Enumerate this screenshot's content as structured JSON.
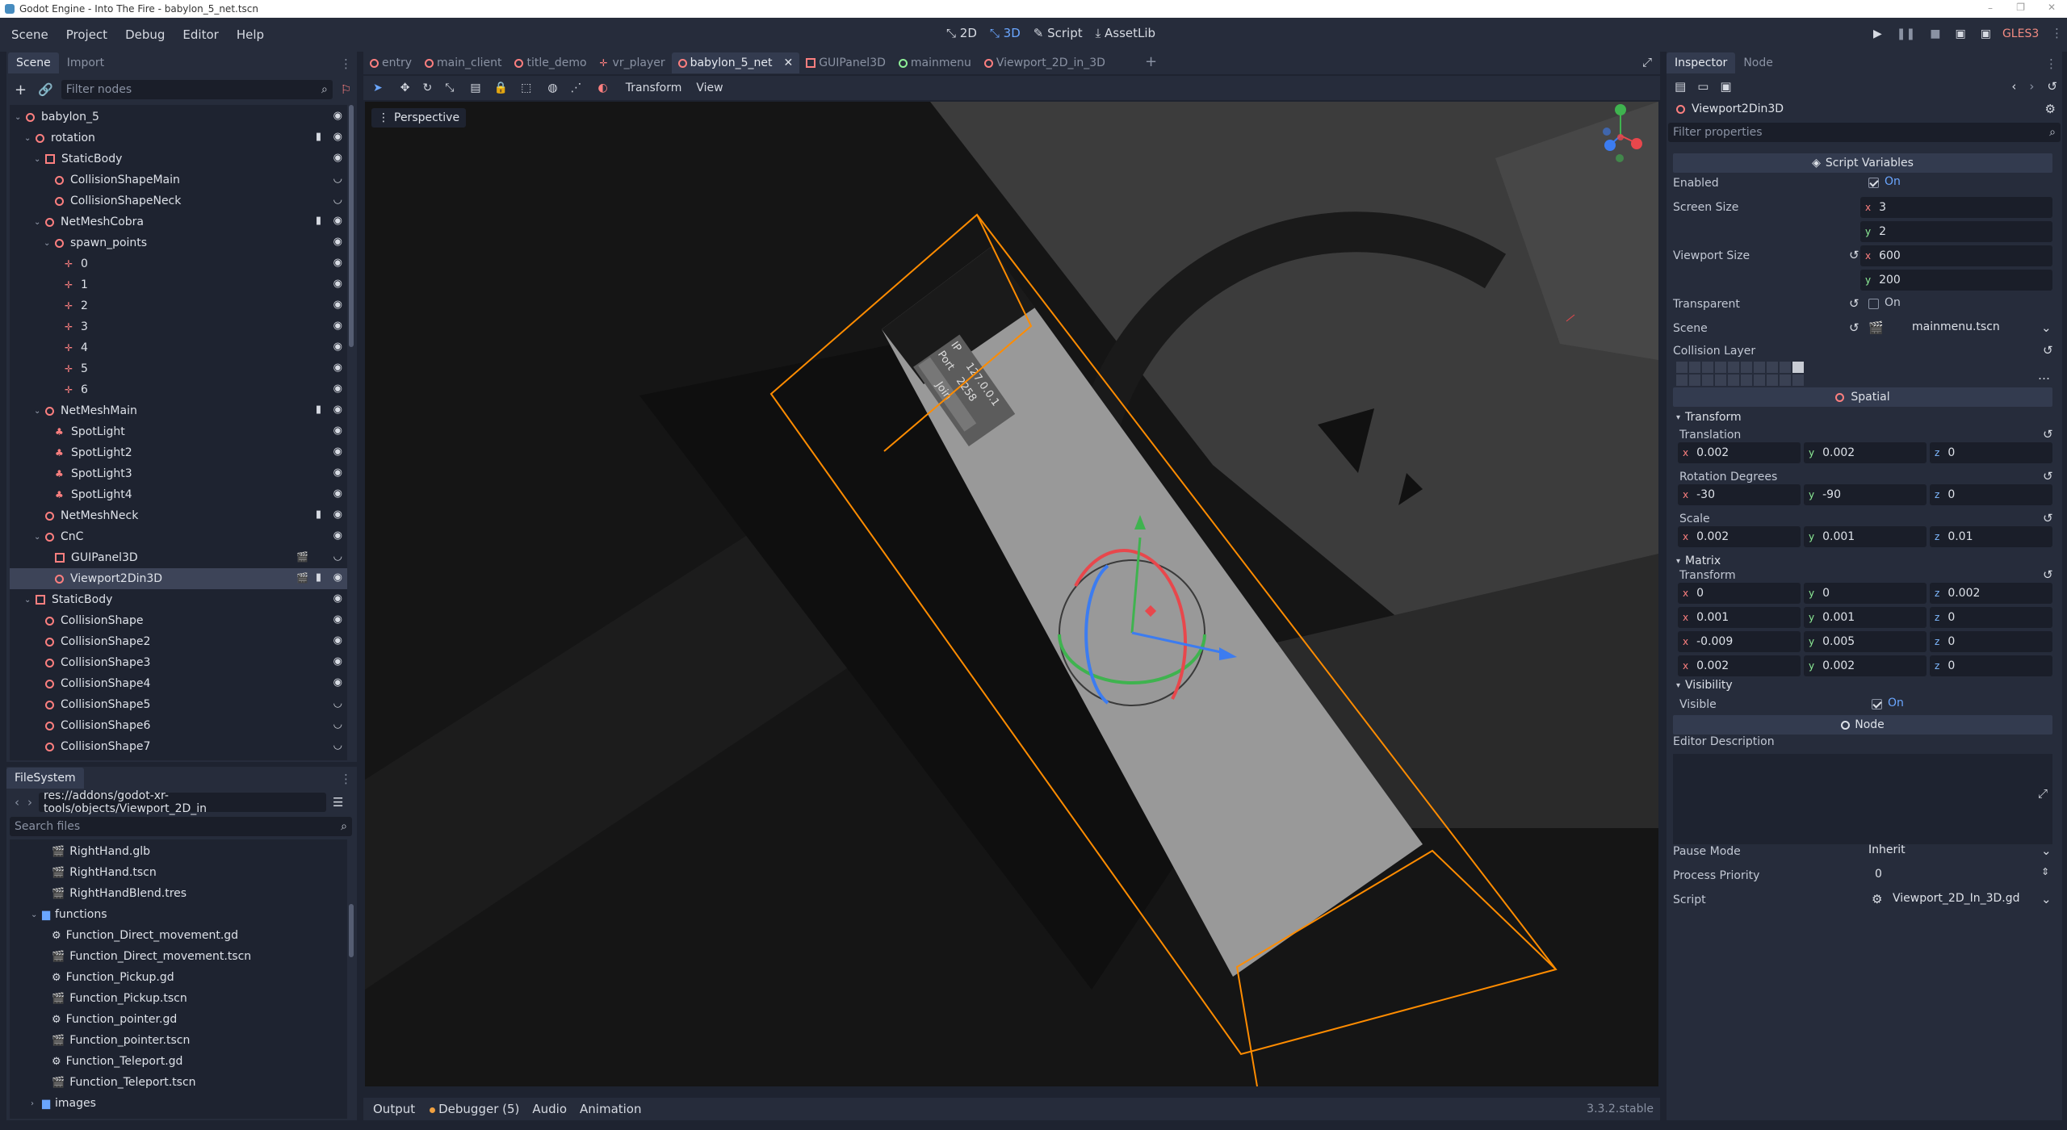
{
  "window": {
    "title": "Godot Engine - Into The Fire - babylon_5_net.tscn"
  },
  "menu": [
    "Scene",
    "Project",
    "Debug",
    "Editor",
    "Help"
  ],
  "workspaces": [
    "2D",
    "3D",
    "Script",
    "AssetLib"
  ],
  "renderer": "GLES3",
  "scene_dock": {
    "tabs": [
      "Scene",
      "Import"
    ],
    "filter_placeholder": "Filter nodes",
    "nodes": [
      {
        "label": "babylon_5"
      },
      {
        "label": "rotation"
      },
      {
        "label": "StaticBody"
      },
      {
        "label": "CollisionShapeMain"
      },
      {
        "label": "CollisionShapeNeck"
      },
      {
        "label": "NetMeshCobra"
      },
      {
        "label": "spawn_points"
      },
      {
        "label": "0"
      },
      {
        "label": "1"
      },
      {
        "label": "2"
      },
      {
        "label": "3"
      },
      {
        "label": "4"
      },
      {
        "label": "5"
      },
      {
        "label": "6"
      },
      {
        "label": "NetMeshMain"
      },
      {
        "label": "SpotLight"
      },
      {
        "label": "SpotLight2"
      },
      {
        "label": "SpotLight3"
      },
      {
        "label": "SpotLight4"
      },
      {
        "label": "NetMeshNeck"
      },
      {
        "label": "CnC"
      },
      {
        "label": "GUIPanel3D"
      },
      {
        "label": "Viewport2Din3D"
      },
      {
        "label": "StaticBody"
      },
      {
        "label": "CollisionShape"
      },
      {
        "label": "CollisionShape2"
      },
      {
        "label": "CollisionShape3"
      },
      {
        "label": "CollisionShape4"
      },
      {
        "label": "CollisionShape5"
      },
      {
        "label": "CollisionShape6"
      },
      {
        "label": "CollisionShape7"
      }
    ]
  },
  "filesystem": {
    "title": "FileSystem",
    "path": "res://addons/godot-xr-tools/objects/Viewport_2D_in",
    "search_placeholder": "Search files",
    "files": [
      {
        "label": "RightHand.glb"
      },
      {
        "label": "RightHand.tscn"
      },
      {
        "label": "RightHandBlend.tres"
      },
      {
        "label": "functions"
      },
      {
        "label": "Function_Direct_movement.gd"
      },
      {
        "label": "Function_Direct_movement.tscn"
      },
      {
        "label": "Function_Pickup.gd"
      },
      {
        "label": "Function_Pickup.tscn"
      },
      {
        "label": "Function_pointer.gd"
      },
      {
        "label": "Function_pointer.tscn"
      },
      {
        "label": "Function_Teleport.gd"
      },
      {
        "label": "Function_Teleport.tscn"
      },
      {
        "label": "images"
      }
    ]
  },
  "scene_tabs": [
    "entry",
    "main_client",
    "title_demo",
    "vr_player",
    "babylon_5_net",
    "GUIPanel3D",
    "mainmenu",
    "Viewport_2D_in_3D"
  ],
  "viewport": {
    "toolbar_menus": [
      "Transform",
      "View"
    ],
    "perspective_label": "Perspective",
    "panel_text": {
      "ip_label": "IP",
      "ip_value": "127.0.0.1",
      "port_label": "Port",
      "port_value": "2258",
      "join": "Join"
    }
  },
  "bottom_panel": {
    "tabs": [
      "Output",
      "Debugger (5)",
      "Audio",
      "Animation"
    ],
    "version": "3.3.2.stable"
  },
  "inspector": {
    "tabs": [
      "Inspector",
      "Node"
    ],
    "node_name": "Viewport2Din3D",
    "filter_placeholder": "Filter properties",
    "script_variables": "Script Variables",
    "enabled": {
      "label": "Enabled",
      "value": "On"
    },
    "screen_size": {
      "label": "Screen Size",
      "x": "3",
      "y": "2"
    },
    "viewport_size": {
      "label": "Viewport Size",
      "x": "600",
      "y": "200"
    },
    "transparent": {
      "label": "Transparent",
      "value": "On"
    },
    "scene": {
      "label": "Scene",
      "value": "mainmenu.tscn"
    },
    "collision_layer": "Collision Layer",
    "spatial": "Spatial",
    "transform_group": "Transform",
    "translation": {
      "label": "Translation",
      "x": "0.002",
      "y": "0.002",
      "z": "0"
    },
    "rotation": {
      "label": "Rotation Degrees",
      "x": "-30",
      "y": "-90",
      "z": "0"
    },
    "scale": {
      "label": "Scale",
      "x": "0.002",
      "y": "0.001",
      "z": "0.01"
    },
    "matrix_group": "Matrix",
    "matrix": {
      "label": "Transform",
      "rows": [
        {
          "x": "0",
          "y": "0",
          "z": "0.002"
        },
        {
          "x": "0.001",
          "y": "0.001",
          "z": "0"
        },
        {
          "x": "-0.009",
          "y": "0.005",
          "z": "0"
        },
        {
          "x": "0.002",
          "y": "0.002",
          "z": "0"
        }
      ]
    },
    "visibility_group": "Visibility",
    "visible": {
      "label": "Visible",
      "value": "On"
    },
    "node_section": "Node",
    "editor_description": "Editor Description",
    "pause_mode": {
      "label": "Pause Mode",
      "value": "Inherit"
    },
    "process_priority": {
      "label": "Process Priority",
      "value": "0"
    },
    "script": {
      "label": "Script",
      "value": "Viewport_2D_In_3D.gd"
    }
  },
  "colors": {
    "accent": "#6aa6ff",
    "node_red": "#fc7f7f",
    "selection_orange": "#ff8c00",
    "bg": "#1e2330",
    "panel": "#262c3b"
  }
}
